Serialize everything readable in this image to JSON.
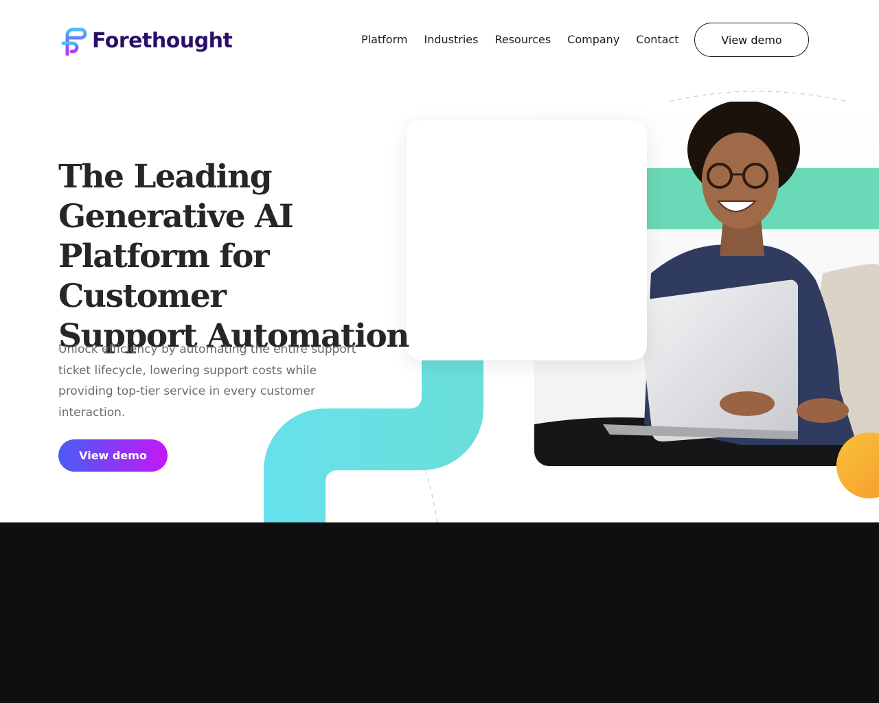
{
  "brand": {
    "name": "Forethought",
    "colors": {
      "logo_text": "#2a0f66",
      "accent_gradient_start": "#4a5cf5",
      "accent_gradient_end": "#c318f5",
      "green_stripe": "#6ad9b8",
      "cyan_shape": "#66e0e8",
      "orange_circle": "#f7b12e",
      "dark_section": "#0f0f0f"
    }
  },
  "nav": {
    "items": [
      "Platform",
      "Industries",
      "Resources",
      "Company",
      "Contact"
    ],
    "cta_label": "View demo"
  },
  "hero": {
    "title": "The Leading\nGenerative AI\nPlatform for Customer\nSupport Automation",
    "subtitle": "Unlock efficiency by automating the entire support ticket lifecycle, lowering support costs while providing top-tier service in every customer interaction.",
    "cta_label": "View demo"
  },
  "icons": [
    "forethought-logo-icon"
  ]
}
